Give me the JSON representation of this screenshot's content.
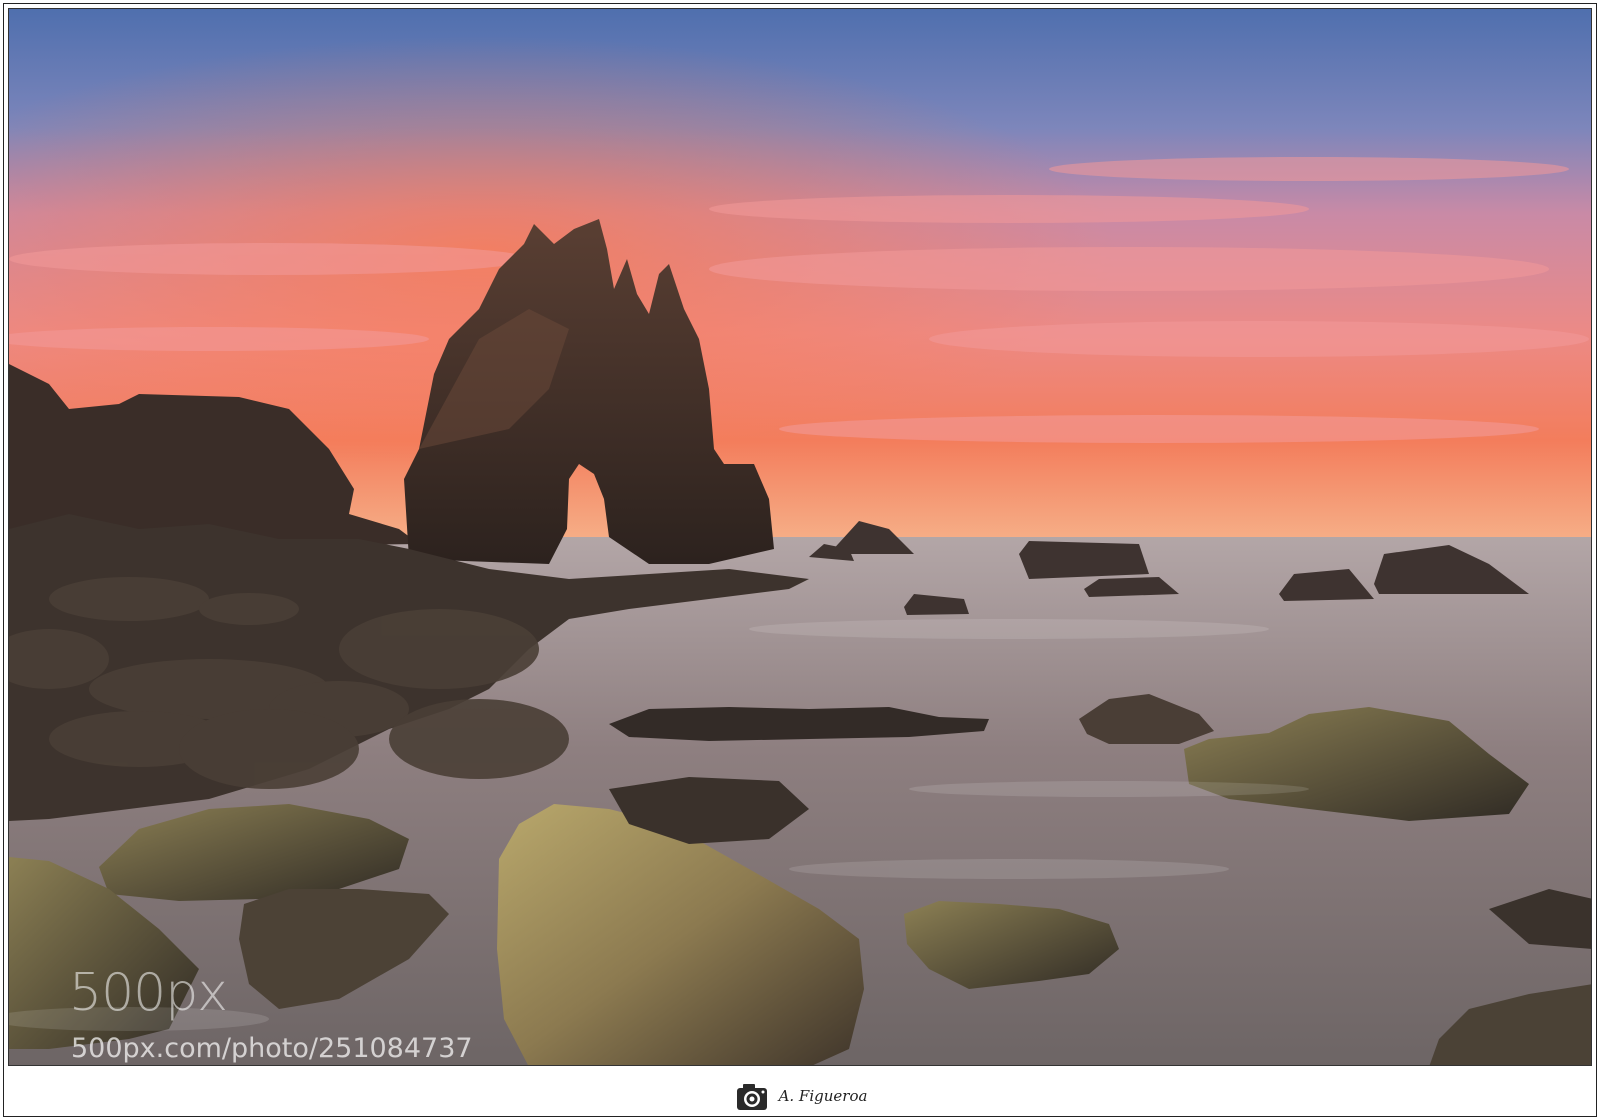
{
  "photo": {
    "subject": "",
    "watermark_logo": "500px",
    "watermark_url": "500px.com/photo/251084737"
  },
  "signature": {
    "text": "A. Figueroa",
    "icon": "camera-logo-icon"
  },
  "colors": {
    "sky_top": "#5a78b4",
    "sky_pink": "#e98a8a",
    "horizon_orange": "#f06a4a",
    "rock_dark": "#3b2e28",
    "water": "#9a8c8c"
  }
}
